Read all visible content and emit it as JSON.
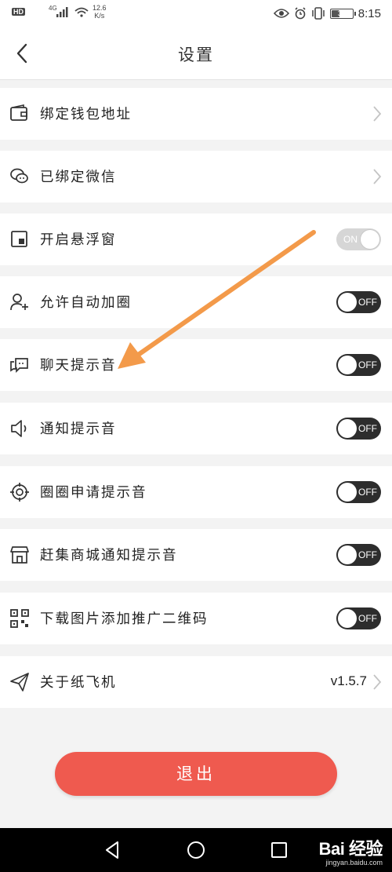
{
  "status_bar": {
    "hd": "HD",
    "network": "4G",
    "speed_value": "12.6",
    "speed_unit": "K/s",
    "battery": "37",
    "time": "8:15"
  },
  "header": {
    "title": "设置",
    "back_icon": "chevron-left-icon"
  },
  "settings": [
    {
      "label": "绑定钱包地址",
      "icon": "wallet-icon",
      "control": "chevron"
    },
    {
      "label": "已绑定微信",
      "icon": "wechat-icon",
      "control": "chevron"
    },
    {
      "label": "开启悬浮窗",
      "icon": "floating-window-icon",
      "control": "toggle",
      "toggle_text": "ON",
      "state": "on"
    },
    {
      "label": "允许自动加圈",
      "icon": "add-user-icon",
      "control": "toggle",
      "toggle_text": "OFF",
      "state": "off"
    },
    {
      "label": "聊天提示音",
      "icon": "chat-icon",
      "control": "toggle",
      "toggle_text": "OFF",
      "state": "off"
    },
    {
      "label": "通知提示音",
      "icon": "speaker-icon",
      "control": "toggle",
      "toggle_text": "OFF",
      "state": "off"
    },
    {
      "label": "圈圈申请提示音",
      "icon": "target-icon",
      "control": "toggle",
      "toggle_text": "OFF",
      "state": "off"
    },
    {
      "label": "赶集商城通知提示音",
      "icon": "store-icon",
      "control": "toggle",
      "toggle_text": "OFF",
      "state": "off"
    },
    {
      "label": "下载图片添加推广二维码",
      "icon": "qr-code-icon",
      "control": "toggle",
      "toggle_text": "OFF",
      "state": "off"
    },
    {
      "label": "关于纸飞机",
      "icon": "paper-plane-icon",
      "control": "version",
      "value": "v1.5.7"
    }
  ],
  "logout_label": "退出",
  "watermark": {
    "logo": "Bai 经验",
    "url": "jingyan.baidu.com"
  },
  "colors": {
    "accent": "#ef5a4f",
    "annotation_arrow": "#f39a4a",
    "toggle_off": "#2d2d2d",
    "toggle_on": "#d6d6d6"
  }
}
